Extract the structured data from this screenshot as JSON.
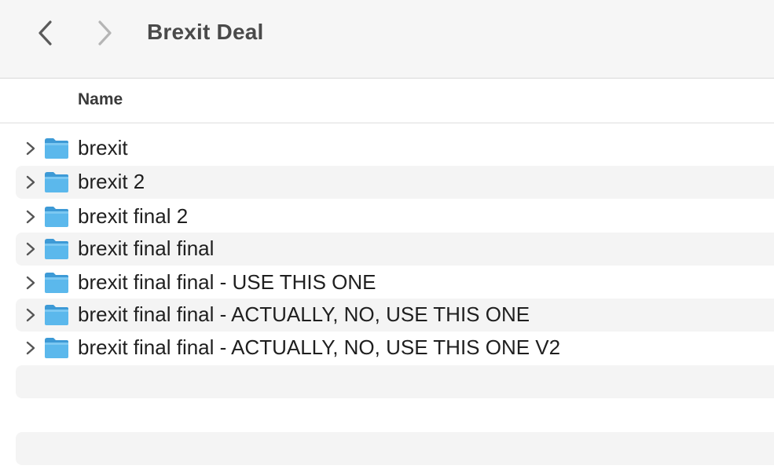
{
  "window": {
    "title": "Brexit Deal"
  },
  "toolbar": {
    "back_icon": "chevron-left-icon",
    "forward_icon": "chevron-right-icon"
  },
  "columns": {
    "name": "Name"
  },
  "files": [
    {
      "name": "brexit",
      "icon": "folder-icon"
    },
    {
      "name": "brexit 2",
      "icon": "folder-icon"
    },
    {
      "name": "brexit final 2",
      "icon": "folder-icon"
    },
    {
      "name": "brexit final final",
      "icon": "folder-icon"
    },
    {
      "name": "brexit final final - USE THIS ONE",
      "icon": "folder-icon"
    },
    {
      "name": "brexit final final - ACTUALLY, NO, USE THIS ONE",
      "icon": "folder-icon"
    },
    {
      "name": "brexit final final - ACTUALLY, NO, USE THIS ONE V2",
      "icon": "folder-icon"
    }
  ],
  "colors": {
    "folder": "#5bb8ec",
    "folder_dark": "#3d9ad6",
    "stripe": "#f4f4f4",
    "titlebar": "#f6f6f6"
  }
}
